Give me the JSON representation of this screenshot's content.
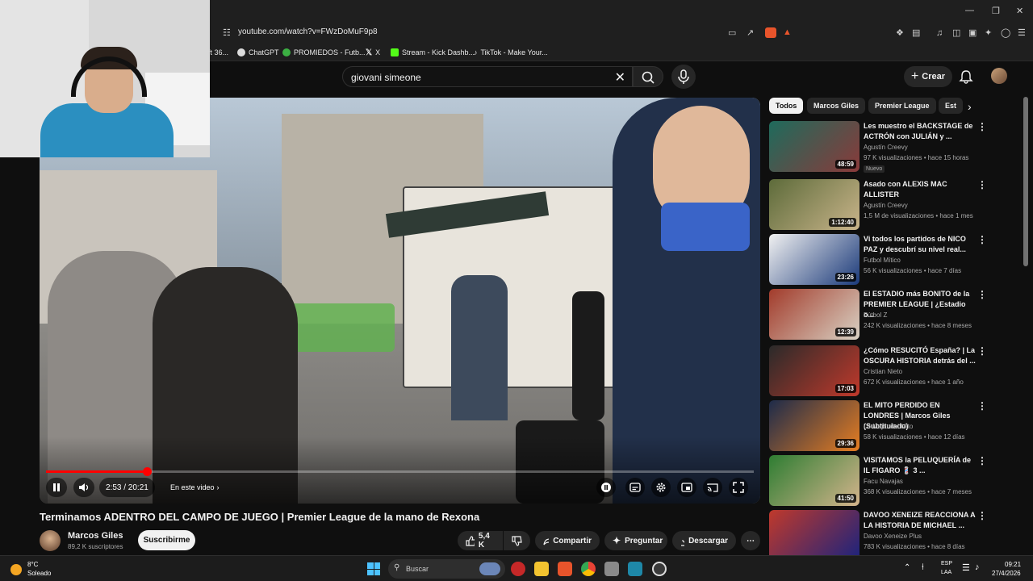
{
  "browser": {
    "url": "youtube.com/watch?v=FWzDoMuF9p8",
    "bookmarks": [
      {
        "label": "ft 36..."
      },
      {
        "label": "ChatGPT"
      },
      {
        "label": "PROMIEDOS - Futb..."
      },
      {
        "label": "X"
      },
      {
        "label": "Stream - Kick Dashb..."
      },
      {
        "label": "TikTok - Make Your..."
      }
    ]
  },
  "header": {
    "search_value": "giovani simeone",
    "create_label": "Crear"
  },
  "player": {
    "time": "2:53 / 20:21",
    "chapter": "En este video",
    "progress_fraction": 0.142
  },
  "video": {
    "title": "Terminamos ADENTRO DEL CAMPO DE JUEGO | Premier League de la mano de Rexona",
    "channel": "Marcos Giles",
    "subscribers": "89,2 K suscriptores",
    "subscribe_label": "Suscribirme",
    "likes": "5,4 K",
    "share_label": "Compartir",
    "ask_label": "Preguntar",
    "download_label": "Descargar"
  },
  "chips": [
    "Todos",
    "Marcos Giles",
    "Premier League",
    "Est"
  ],
  "recommendations": [
    {
      "title": "Les muestro el BACKSTAGE de ACTRÓN con JULIÁN y ...",
      "channel": "Agustín Creevy",
      "meta": "97 K visualizaciones • hace 15 horas",
      "duration": "48:59",
      "badge": "Nuevo",
      "colors": [
        "#1e6b5c",
        "#8a3a3a"
      ]
    },
    {
      "title": "Asado con ALEXIS MAC ALLISTER",
      "channel": "Agustín Creevy",
      "meta": "1,5 M de visualizaciones • hace 1 mes",
      "duration": "1:12:40",
      "badge": "",
      "colors": [
        "#5d6b3a",
        "#c9b48a"
      ]
    },
    {
      "title": "Vi todos los partidos de NICO PAZ y descubrí su nivel real...",
      "channel": "Futbol Mítico",
      "meta": "56 K visualizaciones • hace 7 días",
      "duration": "23:26",
      "badge": "",
      "colors": [
        "#f1f1f1",
        "#1b3a7a"
      ]
    },
    {
      "title": "El ESTADIO más BONITO de la PREMIER LEAGUE | ¿Estadio o...",
      "channel": "Fútbol Z",
      "meta": "242 K visualizaciones • hace 8 meses",
      "duration": "12:39",
      "badge": "",
      "colors": [
        "#a23b2b",
        "#d9d2c4"
      ]
    },
    {
      "title": "¿Cómo RESUCITÓ España? | La OSCURA HISTORIA detrás del ...",
      "channel": "Cristian Nieto",
      "meta": "672 K visualizaciones • hace 1 año",
      "duration": "17:03",
      "badge": "",
      "colors": [
        "#2a2a2a",
        "#c0392b"
      ]
    },
    {
      "title": "EL MITO PERDIDO EN LONDRES | Marcos Giles (Subtitulado)",
      "channel": "Lo Mejor del Mito",
      "meta": "58 K visualizaciones • hace 12 días",
      "duration": "29:36",
      "badge": "",
      "colors": [
        "#1d2b4a",
        "#e67e22"
      ]
    },
    {
      "title": "VISITAMOS la PELUQUERÍA de IL FIGARO 💈 3 ...",
      "channel": "Facu Navajas",
      "meta": "368 K visualizaciones • hace 7 meses",
      "duration": "41:50",
      "badge": "",
      "colors": [
        "#2e7d32",
        "#d4b48c"
      ]
    },
    {
      "title": "DAVOO XENEIZE REACCIONA A LA HISTORIA DE MICHAEL ...",
      "channel": "Davoo Xeneize Plus",
      "meta": "783 K visualizaciones • hace 8 días",
      "duration": "",
      "badge": "",
      "colors": [
        "#c0392b",
        "#1a237e"
      ]
    }
  ],
  "taskbar": {
    "temp": "8°C",
    "weather": "Soleado",
    "search_placeholder": "Buscar",
    "lang1": "ESP",
    "lang2": "LAA",
    "time": "09:21",
    "date": "27/4/2026"
  }
}
